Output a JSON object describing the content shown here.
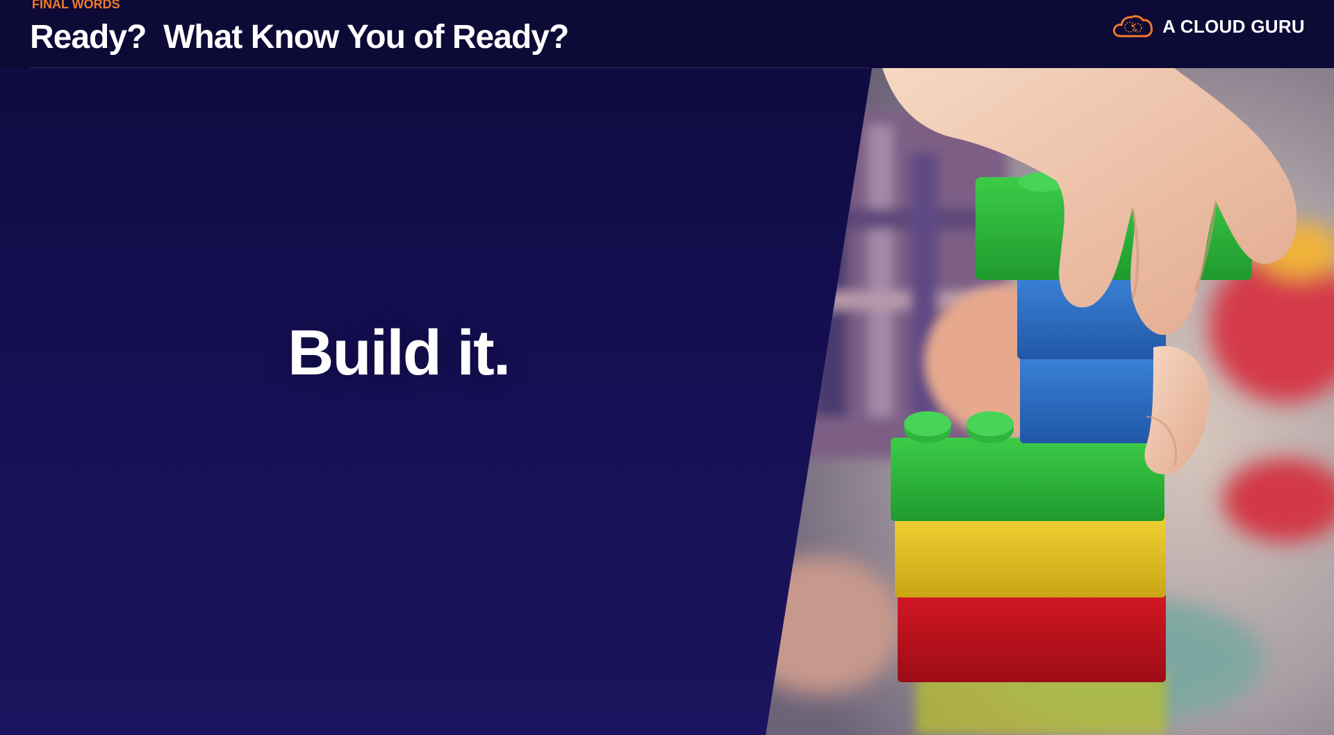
{
  "header": {
    "eyebrow": "FINAL WORDS",
    "title": "Ready?  What Know You of Ready?"
  },
  "brand": {
    "name": "A CLOUD GURU",
    "logo_icon": "cloud-logo-icon",
    "accent_color": "#f07b2a"
  },
  "main": {
    "headline": "Build it."
  },
  "photo": {
    "icon": "lego-blocks-photo",
    "colors": {
      "green": "#2fb53e",
      "blue": "#2c6fc4",
      "yellow": "#e0c12a",
      "red": "#c4101c"
    }
  },
  "theme": {
    "background": "#150f52",
    "header_background": "#0d0a36"
  }
}
